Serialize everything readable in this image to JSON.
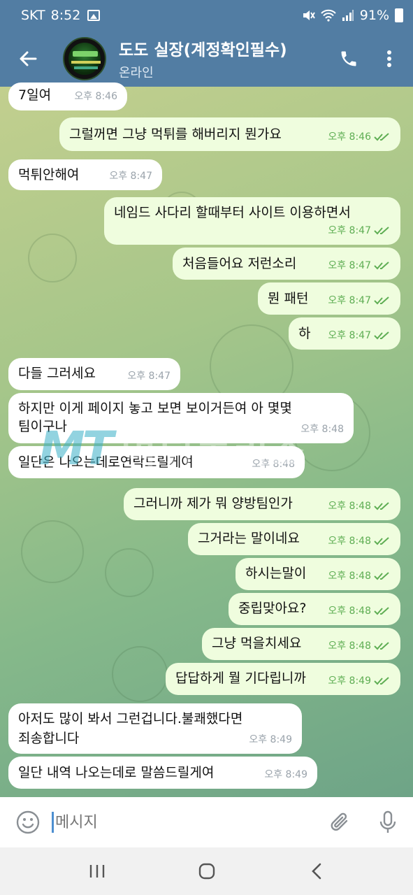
{
  "status_bar": {
    "carrier": "SKT",
    "time": "8:52",
    "battery": "91%"
  },
  "header": {
    "title": "도도 실장(계정확인필수)",
    "subtitle": "온라인"
  },
  "messages": [
    {
      "side": "in",
      "text": "7일여",
      "time": "오후 8:46"
    },
    {
      "side": "out",
      "text": "그럴꺼면 그냥 먹튀를 해버리지 뭔가요",
      "time": "오후 8:46"
    },
    {
      "side": "in",
      "text": "먹튀안해여",
      "time": "오후 8:47"
    },
    {
      "side": "out",
      "text": "네임드 사다리 할때부터 사이트 이용하면서",
      "time": "오후 8:47"
    },
    {
      "side": "out",
      "text": "처음들어요 저런소리",
      "time": "오후 8:47"
    },
    {
      "side": "out",
      "text": "뭔 패턴",
      "time": "오후 8:47"
    },
    {
      "side": "out",
      "text": "하",
      "time": "오후 8:47"
    },
    {
      "side": "in",
      "text": "다들 그러세요",
      "time": "오후 8:47"
    },
    {
      "side": "in",
      "text": "하지만 이게 페이지 놓고 보면 보이거든여 아 몇몇",
      "text2": "팀이구나",
      "time": "오후 8:48"
    },
    {
      "side": "in",
      "text": "일단은 나오는데로연락드릴게여",
      "time": "오후 8:48"
    },
    {
      "side": "out",
      "text": "그러니까 제가 뭐 양방팀인가",
      "time": "오후 8:48"
    },
    {
      "side": "out",
      "text": "그거라는 말이네요",
      "time": "오후 8:48"
    },
    {
      "side": "out",
      "text": "하시는말이",
      "time": "오후 8:48"
    },
    {
      "side": "out",
      "text": "중립맞아요?",
      "time": "오후 8:48"
    },
    {
      "side": "out",
      "text": "그냥 먹을치세요",
      "time": "오후 8:48"
    },
    {
      "side": "out",
      "text": "답답하게 뭘 기다립니까",
      "time": "오후 8:49"
    },
    {
      "side": "in",
      "text": "아저도  많이 봐서 그런겁니다.불쾌했다면",
      "text2": "죄송합니다",
      "time": "오후 8:49"
    },
    {
      "side": "in",
      "text": "일단 내역 나오는데로 말씀드릴게여",
      "time": "오후 8:49"
    }
  ],
  "watermark": {
    "logo": "MT",
    "text": "먹튀폴리스"
  },
  "input": {
    "placeholder": "메시지"
  },
  "colors": {
    "header": "#527da3",
    "outgoing_bubble": "#effdde",
    "incoming_bubble": "#ffffff",
    "read_check": "#5fae54"
  },
  "icons": [
    "back-arrow-icon",
    "phone-icon",
    "more-vert-icon",
    "emoji-icon",
    "paperclip-icon",
    "mic-icon",
    "recents-icon",
    "home-icon",
    "nav-back-icon"
  ]
}
